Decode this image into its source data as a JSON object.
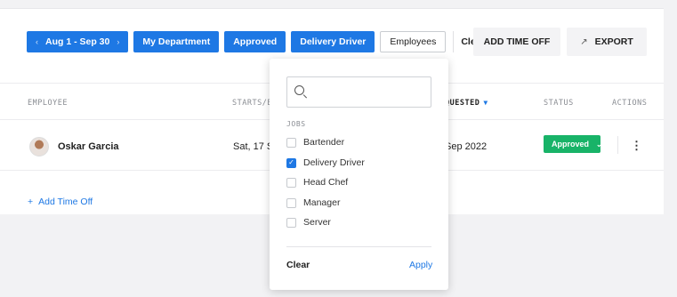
{
  "toolbar": {
    "date_range": "Aug 1 - Sep 30",
    "filters": [
      "My Department",
      "Approved",
      "Delivery Driver"
    ],
    "employees_label": "Employees",
    "clear_all": "Clear all",
    "add_time_off": "ADD TIME OFF",
    "export": "EXPORT"
  },
  "table": {
    "columns": {
      "employee": "EMPLOYEE",
      "starts": "STARTS/E",
      "requested": "QUESTED",
      "status": "STATUS",
      "actions": "ACTIONS"
    },
    "rows": [
      {
        "name": "Oskar Garcia",
        "starts": "Sat, 17 S",
        "requested": "Sep 2022",
        "status": "Approved"
      }
    ],
    "add_time_off_link": "Add Time Off"
  },
  "dropdown": {
    "search_placeholder": "",
    "section_label": "JOBS",
    "options": [
      {
        "label": "Bartender",
        "checked": false
      },
      {
        "label": "Delivery Driver",
        "checked": true
      },
      {
        "label": "Head Chef",
        "checked": false
      },
      {
        "label": "Manager",
        "checked": false
      },
      {
        "label": "Server",
        "checked": false
      }
    ],
    "clear_label": "Clear",
    "apply_label": "Apply"
  },
  "colors": {
    "accent": "#1e78e4",
    "approved": "#18b368"
  }
}
